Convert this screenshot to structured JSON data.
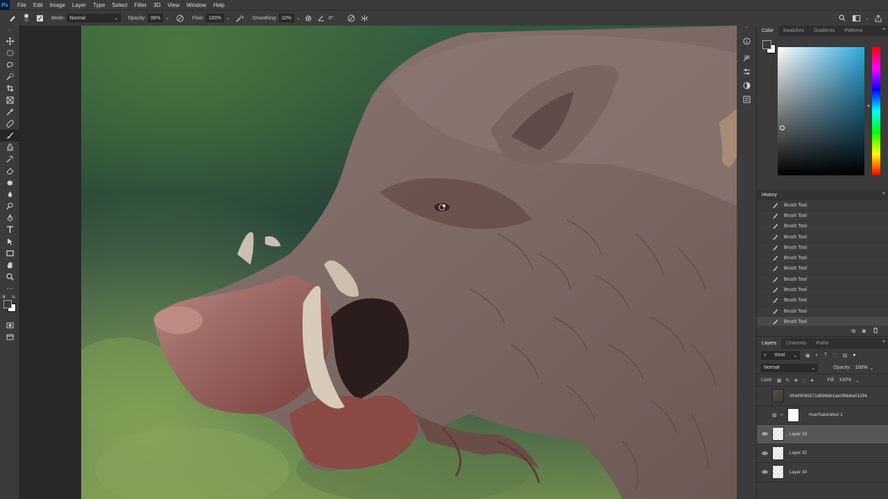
{
  "menubar": {
    "logo": "Ps",
    "items": [
      "File",
      "Edit",
      "Image",
      "Layer",
      "Type",
      "Select",
      "Filter",
      "3D",
      "View",
      "Window",
      "Help"
    ]
  },
  "options": {
    "mode_label": "Mode:",
    "mode_value": "Normal",
    "opacity_label": "Opacity:",
    "opacity_value": "99%",
    "flow_label": "Flow:",
    "flow_value": "100%",
    "smoothing_label": "Smoothing:",
    "smoothing_value": "10%",
    "angle_value": "0°",
    "brush_size": "15"
  },
  "tools": [
    "move-tool",
    "marquee-tool",
    "lasso-tool",
    "quick-select-tool",
    "crop-tool",
    "frame-tool",
    "eyedropper-tool",
    "healing-tool",
    "brush-tool",
    "stamp-tool",
    "history-brush-tool",
    "eraser-tool",
    "gradient-tool",
    "blur-tool",
    "dodge-tool",
    "pen-tool",
    "type-tool",
    "path-select-tool",
    "shape-tool",
    "hand-tool",
    "zoom-tool",
    "more-tool"
  ],
  "color_panel": {
    "tabs": [
      "Color",
      "Swatches",
      "Gradients",
      "Patterns"
    ],
    "active_tab": "Color",
    "hue_color": "#2aa8e0",
    "foreground": "#3a3a3a",
    "background": "#ffffff"
  },
  "history": {
    "title": "History",
    "items": [
      "Brush Tool",
      "Brush Tool",
      "Brush Tool",
      "Brush Tool",
      "Brush Tool",
      "Brush Tool",
      "Brush Tool",
      "Brush Tool",
      "Brush Tool",
      "Brush Tool",
      "Brush Tool",
      "Brush Tool"
    ]
  },
  "layers_panel": {
    "tabs": [
      "Layers",
      "Channels",
      "Paths"
    ],
    "active_tab": "Layers",
    "filter_label": "Kind",
    "blend_mode": "Normal",
    "opacity_label": "Opacity:",
    "opacity_value": "100%",
    "lock_label": "Lock:",
    "fill_label": "Fill:",
    "fill_value": "100%",
    "layers": [
      {
        "name": "95489069371d696bb1ad1ffbbba01294",
        "visible": false
      },
      {
        "name": "Hue/Saturation 1",
        "visible": false
      },
      {
        "name": "Layer 33",
        "visible": true
      },
      {
        "name": "Layer 32",
        "visible": true
      },
      {
        "name": "Layer 30",
        "visible": true
      }
    ]
  }
}
